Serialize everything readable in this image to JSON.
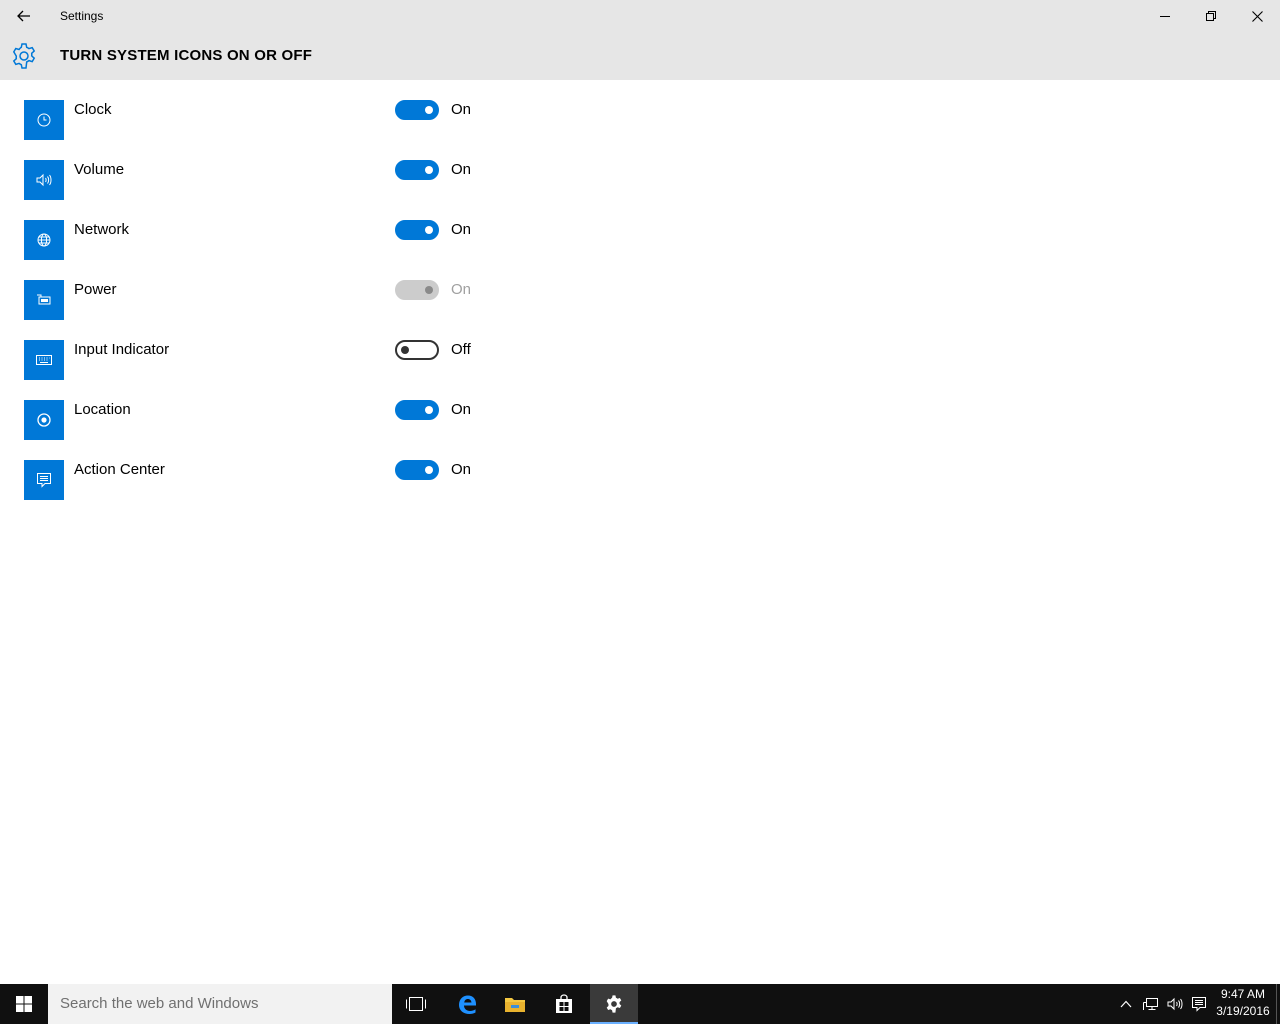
{
  "window": {
    "title": "Settings",
    "back_icon": "back-arrow-icon",
    "controls": [
      "minimize-icon",
      "maximize-icon",
      "close-icon"
    ]
  },
  "header": {
    "icon": "gear-icon",
    "title": "TURN SYSTEM ICONS ON OR OFF"
  },
  "colors": {
    "accent": "#0078d7",
    "chrome": "#e6e6e6",
    "taskbar": "#101010",
    "disabled": "#cccccc"
  },
  "settings": [
    {
      "label": "Clock",
      "icon": "clock-icon",
      "state": "On",
      "enabled": true
    },
    {
      "label": "Volume",
      "icon": "volume-icon",
      "state": "On",
      "enabled": true
    },
    {
      "label": "Network",
      "icon": "network-globe-icon",
      "state": "On",
      "enabled": true
    },
    {
      "label": "Power",
      "icon": "battery-icon",
      "state": "On",
      "enabled": false
    },
    {
      "label": "Input Indicator",
      "icon": "keyboard-icon",
      "state": "Off",
      "enabled": true
    },
    {
      "label": "Location",
      "icon": "location-icon",
      "state": "On",
      "enabled": true
    },
    {
      "label": "Action Center",
      "icon": "action-center-icon",
      "state": "On",
      "enabled": true
    }
  ],
  "taskbar": {
    "search_placeholder": "Search the web and Windows",
    "time": "9:47 AM",
    "date": "3/19/2016",
    "pinned": [
      "task-view-icon",
      "edge-icon",
      "file-explorer-icon",
      "store-icon",
      "settings-gear-icon"
    ],
    "tray": [
      "chevron-up-icon",
      "network-icon",
      "volume-icon",
      "action-center-icon"
    ]
  }
}
